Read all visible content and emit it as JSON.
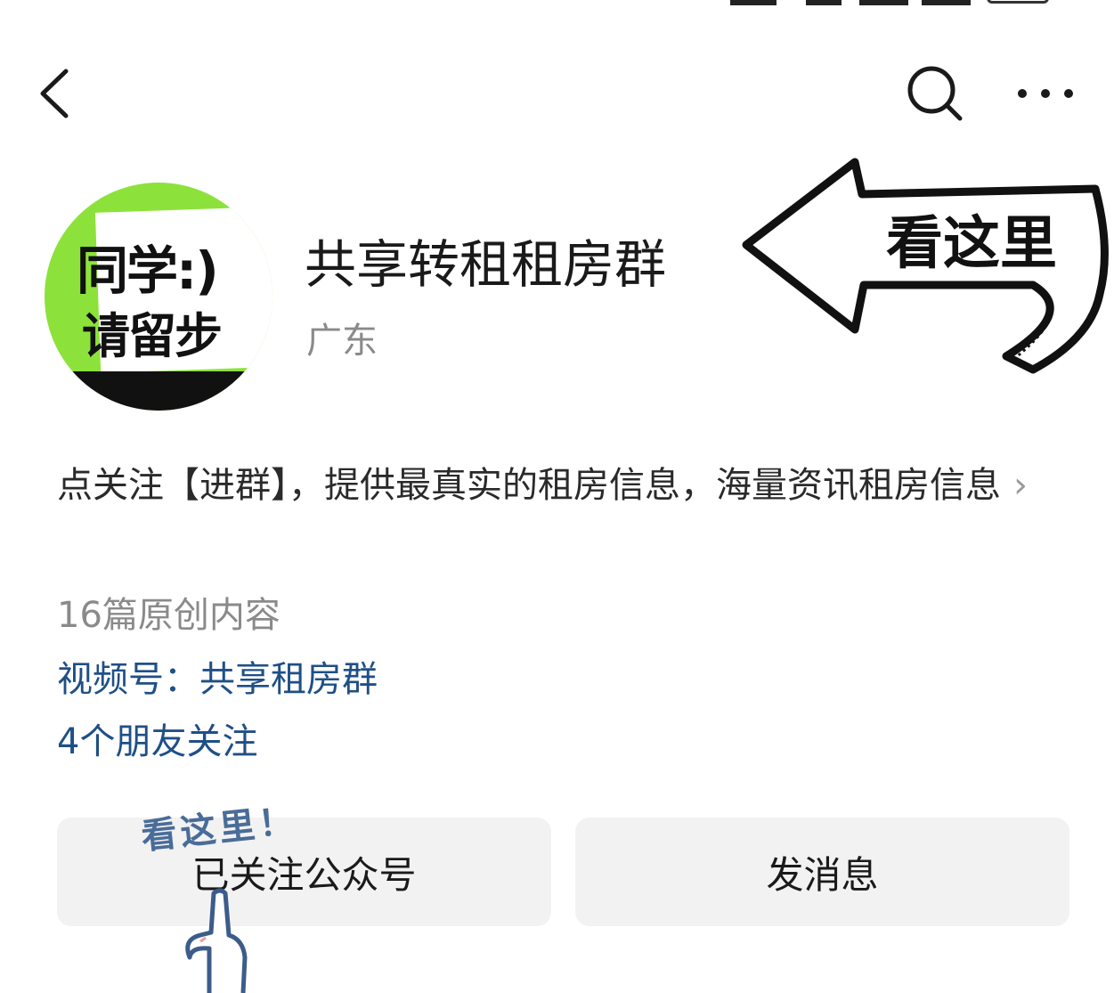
{
  "nav": {
    "back_icon": "chevron-left-icon",
    "search_icon": "search-icon",
    "more_icon": "more-dots-icon"
  },
  "avatar": {
    "line1": "同学:)",
    "line2": "请留步",
    "green": "#8ce23a"
  },
  "account": {
    "name": "共享转租租房群",
    "region": "广东"
  },
  "annotation": {
    "arrow_text": "看这里",
    "hint_text": "看这里！"
  },
  "profile": {
    "description": "点关注【进群】，提供最真实的租房信息，海量资讯租房信息",
    "original_count": "16篇原创内容",
    "channel": "视频号：共享租房群",
    "friends_following": "4个朋友关注"
  },
  "actions": {
    "followed_label": "已关注公众号",
    "message_label": "发消息"
  },
  "colors": {
    "link": "#1f4f86",
    "muted": "#8a8a8a",
    "button_bg": "#f2f2f2"
  }
}
